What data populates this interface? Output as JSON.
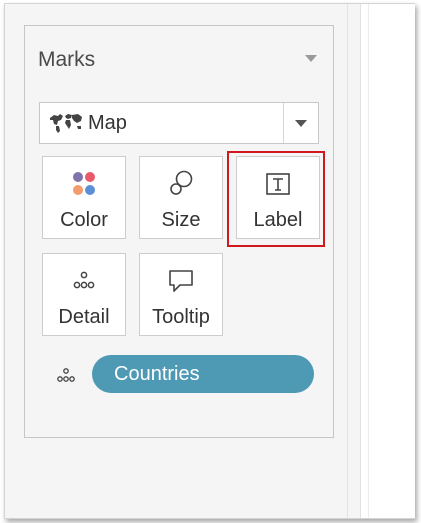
{
  "marks_card": {
    "title": "Marks",
    "mark_type": {
      "selected": "Map"
    },
    "buttons": [
      {
        "id": "color",
        "label": "Color",
        "icon": "color-dots-icon"
      },
      {
        "id": "size",
        "label": "Size",
        "icon": "size-circles-icon"
      },
      {
        "id": "label",
        "label": "Label",
        "icon": "text-label-icon",
        "highlighted": true
      },
      {
        "id": "detail",
        "label": "Detail",
        "icon": "detail-dots-icon"
      },
      {
        "id": "tooltip",
        "label": "Tooltip",
        "icon": "speech-bubble-icon"
      }
    ],
    "fields": [
      {
        "name": "Countries",
        "encoding": "detail",
        "color": "#4e99b4"
      }
    ],
    "colors": {
      "highlight": "#d0181f",
      "pill": "#4e99b4",
      "color_dots": [
        "#8073ac",
        "#e8596c",
        "#f39c6b",
        "#5b8fd6"
      ]
    }
  }
}
